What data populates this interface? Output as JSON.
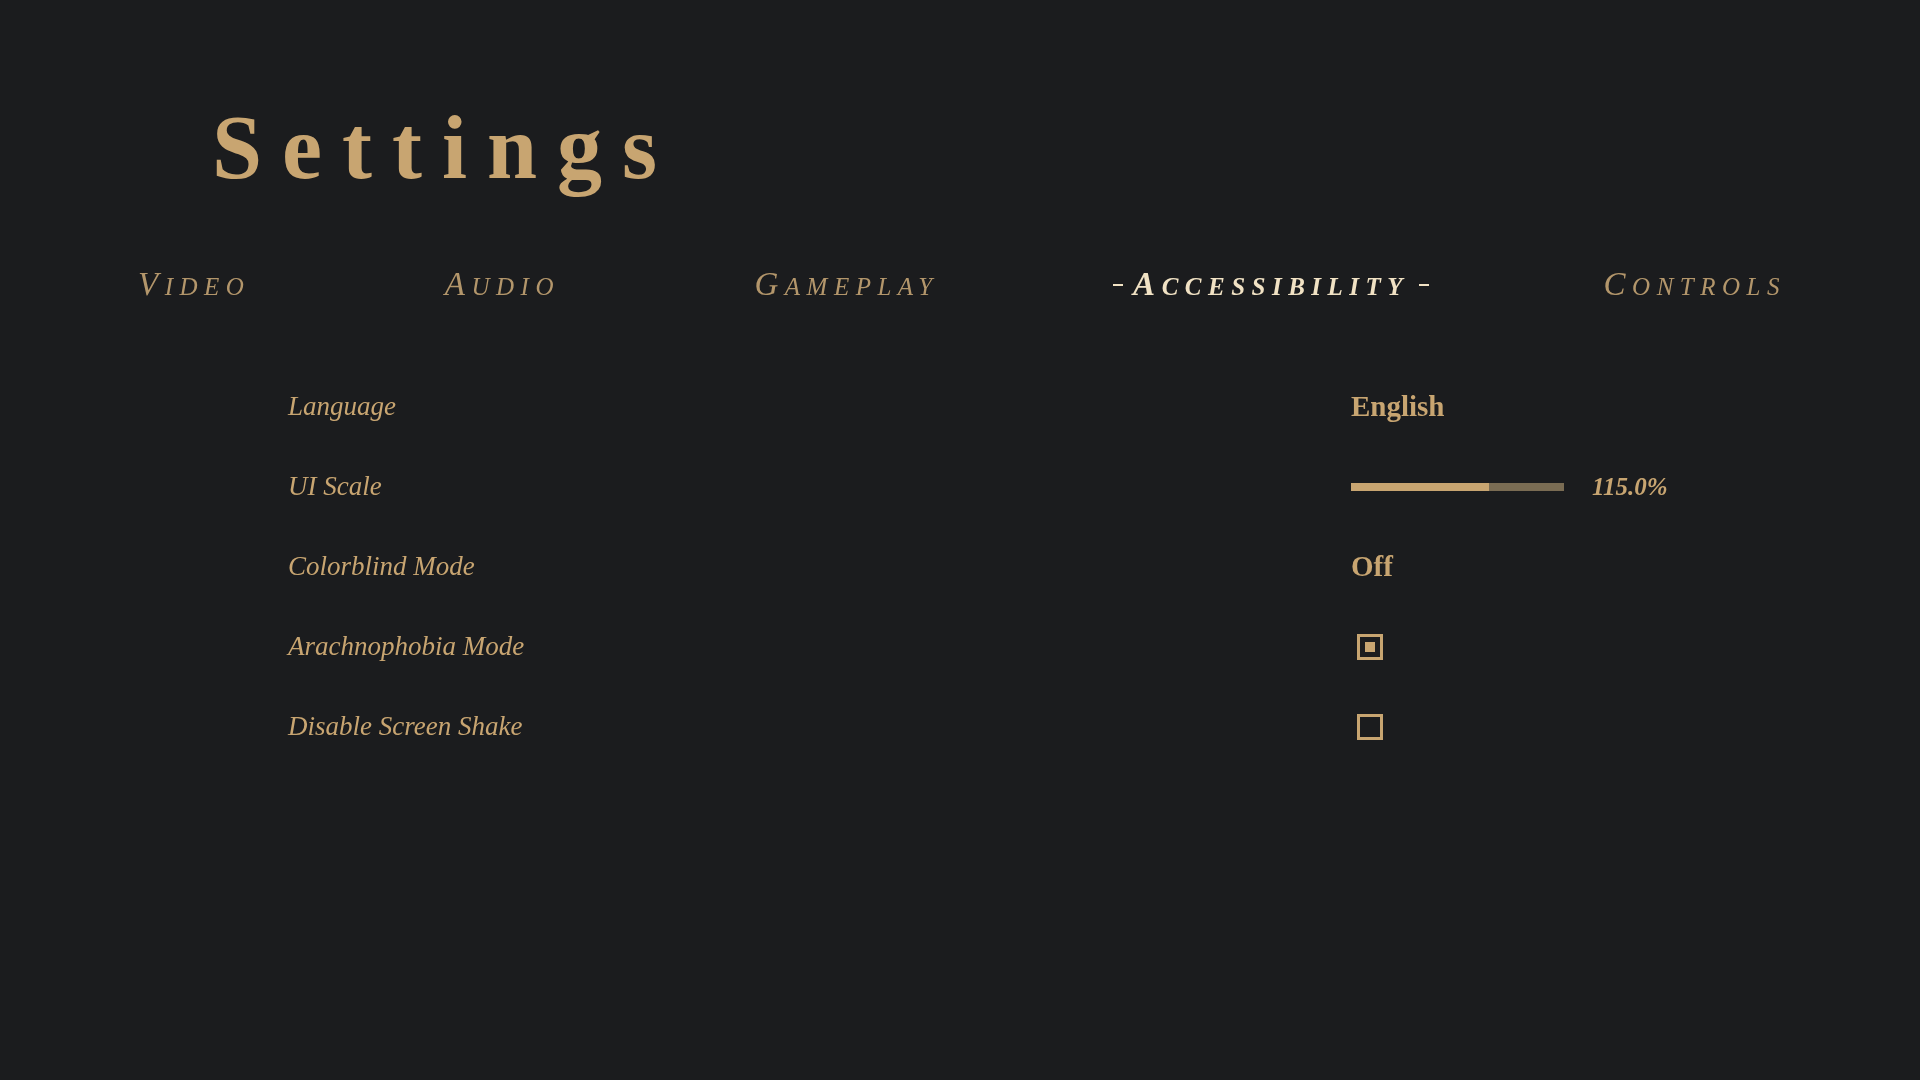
{
  "title": "Settings",
  "tabs": [
    {
      "label": "VIDEO",
      "selected": false
    },
    {
      "label": "AUDIO",
      "selected": false
    },
    {
      "label": "GAMEPLAY",
      "selected": false
    },
    {
      "label": "ACCESSIBILITY",
      "selected": true
    },
    {
      "label": "CONTROLS",
      "selected": false
    }
  ],
  "settings": [
    {
      "kind": "value",
      "label": "Language",
      "value": "English"
    },
    {
      "kind": "slider",
      "label": "UI Scale",
      "level": 0.65,
      "reading": "115.0%"
    },
    {
      "kind": "value",
      "label": "Colorblind Mode",
      "value": "Off"
    },
    {
      "kind": "checkbox",
      "label": "Arachnophobia Mode",
      "checked": true
    },
    {
      "kind": "checkbox",
      "label": "Disable Screen Shake",
      "checked": false
    }
  ]
}
